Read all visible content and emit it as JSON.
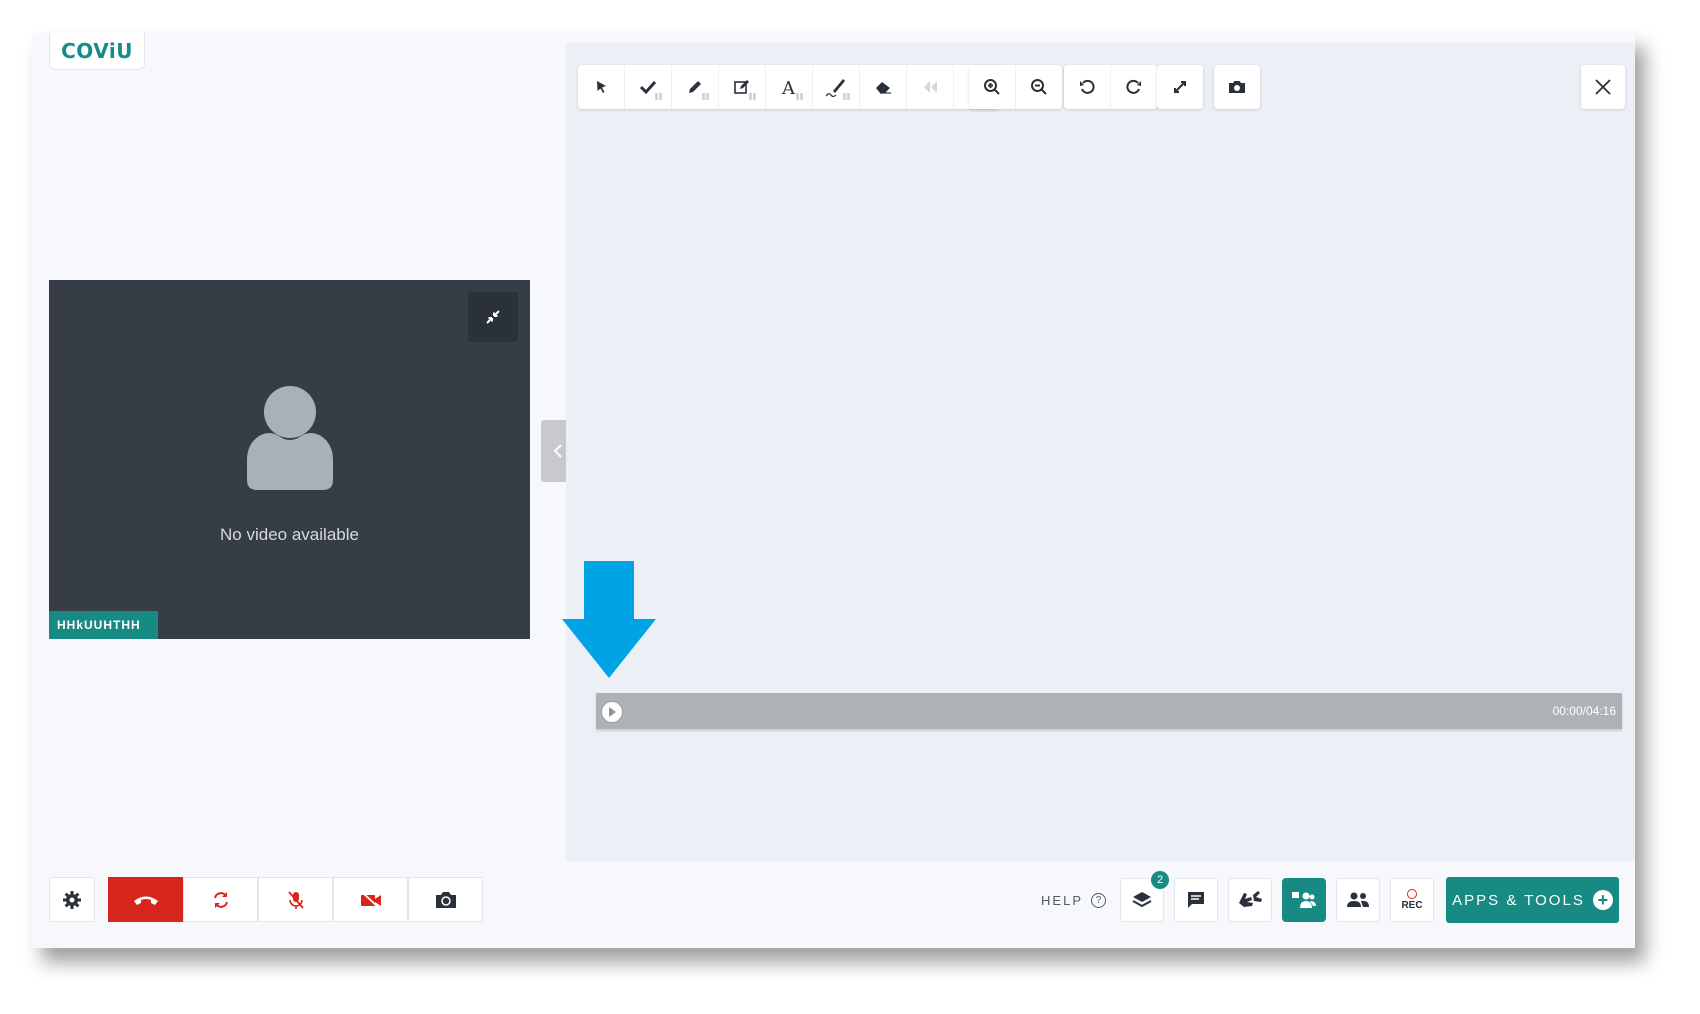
{
  "app": {
    "logo_text": "COViU"
  },
  "video": {
    "status_text": "No video available",
    "participant_name": "HHkUUHTHH"
  },
  "whiteboard": {
    "toolbar_groups": [
      [
        "pointer-icon",
        "check-icon",
        "pencil-icon",
        "edit-icon",
        "text-icon",
        "pen-icon",
        "eraser-icon",
        "rewind-icon",
        "clear-icon"
      ],
      [
        "zoom-in-icon",
        "zoom-out-icon"
      ],
      [
        "undo-icon",
        "redo-icon"
      ],
      [
        "fullscreen-icon"
      ],
      [
        "camera-icon"
      ]
    ],
    "media_player": {
      "time": "00:00/04:16",
      "progress": 0
    }
  },
  "bottom_bar": {
    "help_label": "HELP",
    "layers_badge": "2",
    "rec_label": "REC",
    "apps_label": "APPS & TOOLS"
  },
  "colors": {
    "brand": "#178a84",
    "end_call": "#d7261e",
    "annotation_arrow": "#00a4e4"
  }
}
